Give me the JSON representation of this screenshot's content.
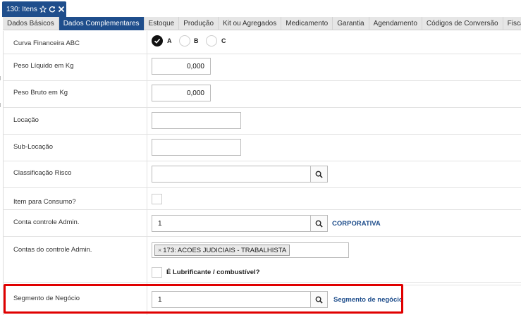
{
  "window": {
    "title": "130: Itens"
  },
  "tabs": [
    {
      "label": "Dados Básicos",
      "active": false
    },
    {
      "label": "Dados Complementares",
      "active": true
    },
    {
      "label": "Estoque",
      "active": false
    },
    {
      "label": "Produção",
      "active": false
    },
    {
      "label": "Kit ou Agregados",
      "active": false
    },
    {
      "label": "Medicamento",
      "active": false
    },
    {
      "label": "Garantia",
      "active": false
    },
    {
      "label": "Agendamento",
      "active": false
    },
    {
      "label": "Códigos de Conversão",
      "active": false
    },
    {
      "label": "Fiscal",
      "active": false
    }
  ],
  "form": {
    "curva": {
      "label": "Curva Financeira ABC",
      "options": [
        "A",
        "B",
        "C"
      ],
      "selected": "A"
    },
    "peso_liquido": {
      "label": "Peso Líquido em Kg",
      "value": "0,000"
    },
    "peso_bruto": {
      "label": "Peso Bruto em Kg",
      "value": "0,000"
    },
    "locacao": {
      "label": "Locação",
      "value": ""
    },
    "sub_locacao": {
      "label": "Sub-Locação",
      "value": ""
    },
    "classificacao_risco": {
      "label": "Classificação Risco",
      "value": ""
    },
    "item_consumo": {
      "label": "Item para Consumo?",
      "checked": false
    },
    "conta_controle": {
      "label": "Conta controle Admin.",
      "value": "1",
      "description": "CORPORATIVA"
    },
    "contas_controle": {
      "label": "Contas do controle Admin.",
      "chips": [
        "173: ACOES JUDICIAIS - TRABALHISTA"
      ],
      "chip_remove": "×"
    },
    "lubrificante": {
      "label": "É Lubrificante / combustível?",
      "checked": false
    },
    "segmento": {
      "label": "Segmento de Negócio",
      "value": "1",
      "description": "Segmento de negócio"
    }
  },
  "colors": {
    "accent": "#1f4e8c",
    "highlight": "#e00000"
  }
}
